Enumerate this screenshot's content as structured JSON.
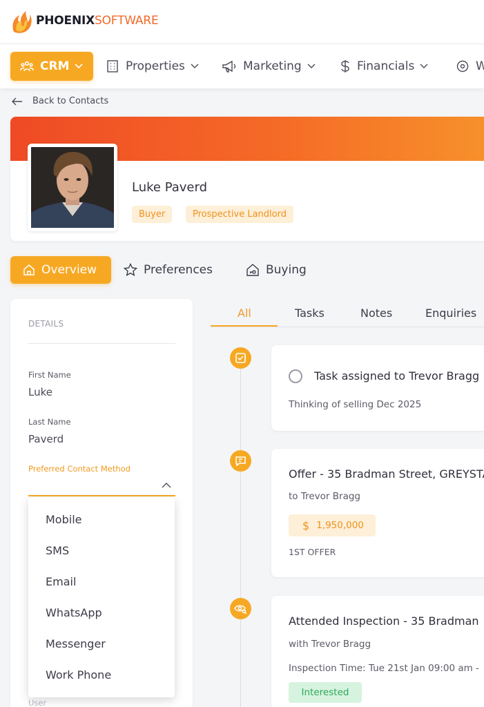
{
  "brand": {
    "name_bold": "PHOENIX",
    "name_light": "SOFTWARE"
  },
  "nav": [
    {
      "label": "CRM",
      "icon": "people-icon"
    },
    {
      "label": "Properties",
      "icon": "building-icon"
    },
    {
      "label": "Marketing",
      "icon": "megaphone-icon"
    },
    {
      "label": "Financials",
      "icon": "dollar-icon"
    },
    {
      "label": "W",
      "icon": "eye-settings-icon"
    }
  ],
  "back_label": "Back to Contacts",
  "profile": {
    "name": "Luke Paverd",
    "tags": [
      "Buyer",
      "Prospective Landlord"
    ]
  },
  "main_tabs": [
    {
      "label": "Overview",
      "icon": "home-icon",
      "active": true
    },
    {
      "label": "Preferences",
      "icon": "star-icon",
      "active": false
    },
    {
      "label": "Buying",
      "icon": "house-key-icon",
      "active": false
    }
  ],
  "details": {
    "heading": "DETAILS",
    "first_name_label": "First Name",
    "first_name": "Luke",
    "last_name_label": "Last Name",
    "last_name": "Paverd",
    "preferred_contact_label": "Preferred Contact Method",
    "user_label": "User",
    "contact_options": [
      "Mobile",
      "SMS",
      "Email",
      "WhatsApp",
      "Messenger",
      "Work Phone"
    ]
  },
  "timeline_tabs": [
    "All",
    "Tasks",
    "Notes",
    "Enquiries"
  ],
  "timeline": {
    "task": {
      "title": "Task assigned to Trevor Bragg",
      "note": "Thinking of selling Dec 2025"
    },
    "offer": {
      "title": "Offer - 35 Bradman Street, GREYSTA",
      "to": "to Trevor Bragg",
      "amount": "1,950,000",
      "currency": "$",
      "note": "1ST OFFER"
    },
    "inspection": {
      "title": "Attended Inspection - 35 Bradman",
      "with": "with Trevor Bragg",
      "time": "Inspection Time: Tue 21st Jan 09:00 am -",
      "status": "Interested"
    }
  },
  "colors": {
    "accent": "#f7a823",
    "banner_start": "#ef4a25",
    "banner_end": "#f7922a",
    "success": "#2ea857"
  }
}
